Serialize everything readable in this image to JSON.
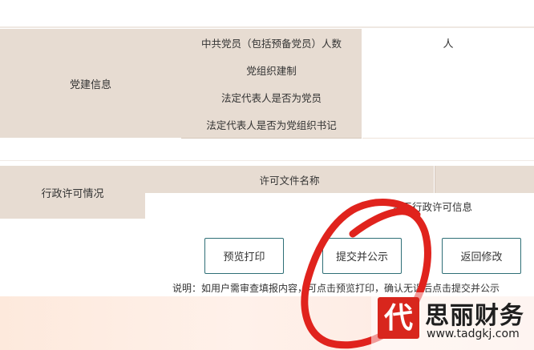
{
  "party_building": {
    "section_label": "党建信息",
    "rows": [
      {
        "label": "中共党员（包括预备党员）人数",
        "value": "人"
      },
      {
        "label": "党组织建制",
        "value": ""
      },
      {
        "label": "法定代表人是否为党员",
        "value": ""
      },
      {
        "label": "法定代表人是否为党组织书记",
        "value": ""
      }
    ]
  },
  "admin_license": {
    "section_label": "行政许可情况",
    "column_header": "许可文件名称",
    "empty_text": "暂无行政许可信息"
  },
  "actions": {
    "preview_print": "预览打印",
    "submit_publish": "提交并公示",
    "back_edit": "返回修改"
  },
  "note": "说明：如用户需审查填报内容，可点击预览打印，确认无误后点击提交并公示",
  "annotation": {
    "circle_color": "#e0231d"
  },
  "watermark": {
    "logo_char": "代",
    "brand": "思丽财务",
    "url": "www.tadgkj.com"
  },
  "colors": {
    "label_bg": "#e7dcd2",
    "button_border": "#2f6f77"
  }
}
